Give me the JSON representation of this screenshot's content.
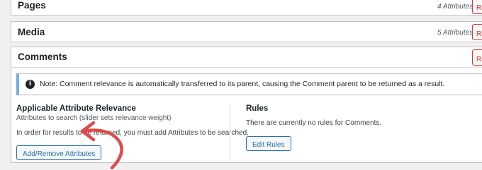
{
  "rows": {
    "pages": {
      "title": "Pages",
      "count": "4 Attributes",
      "remove_label": "Remove"
    },
    "media": {
      "title": "Media",
      "count": "5 Attributes",
      "remove_label": "Remove"
    },
    "comments": {
      "title": "Comments",
      "remove_label": "Remove"
    }
  },
  "notice": {
    "text": "Note: Comment relevance is automatically transferred to its parent, causing the Comment parent to be returned as a result.",
    "icon": "info-icon"
  },
  "attributes_panel": {
    "title": "Applicable Attribute Relevance",
    "subtitle": "Attributes to search (slider sets relevance weight)",
    "message": "In order for results to be returned, you must add Attributes to be searched.",
    "button_label": "Add/Remove Attributes"
  },
  "rules_panel": {
    "title": "Rules",
    "message": "There are currently no rules for Comments.",
    "button_label": "Edit Rules"
  },
  "colors": {
    "accent": "#2271b1",
    "remove": "#d63638",
    "notice_border": "#72aee6",
    "annotation_arrow": "#e04a4a"
  }
}
